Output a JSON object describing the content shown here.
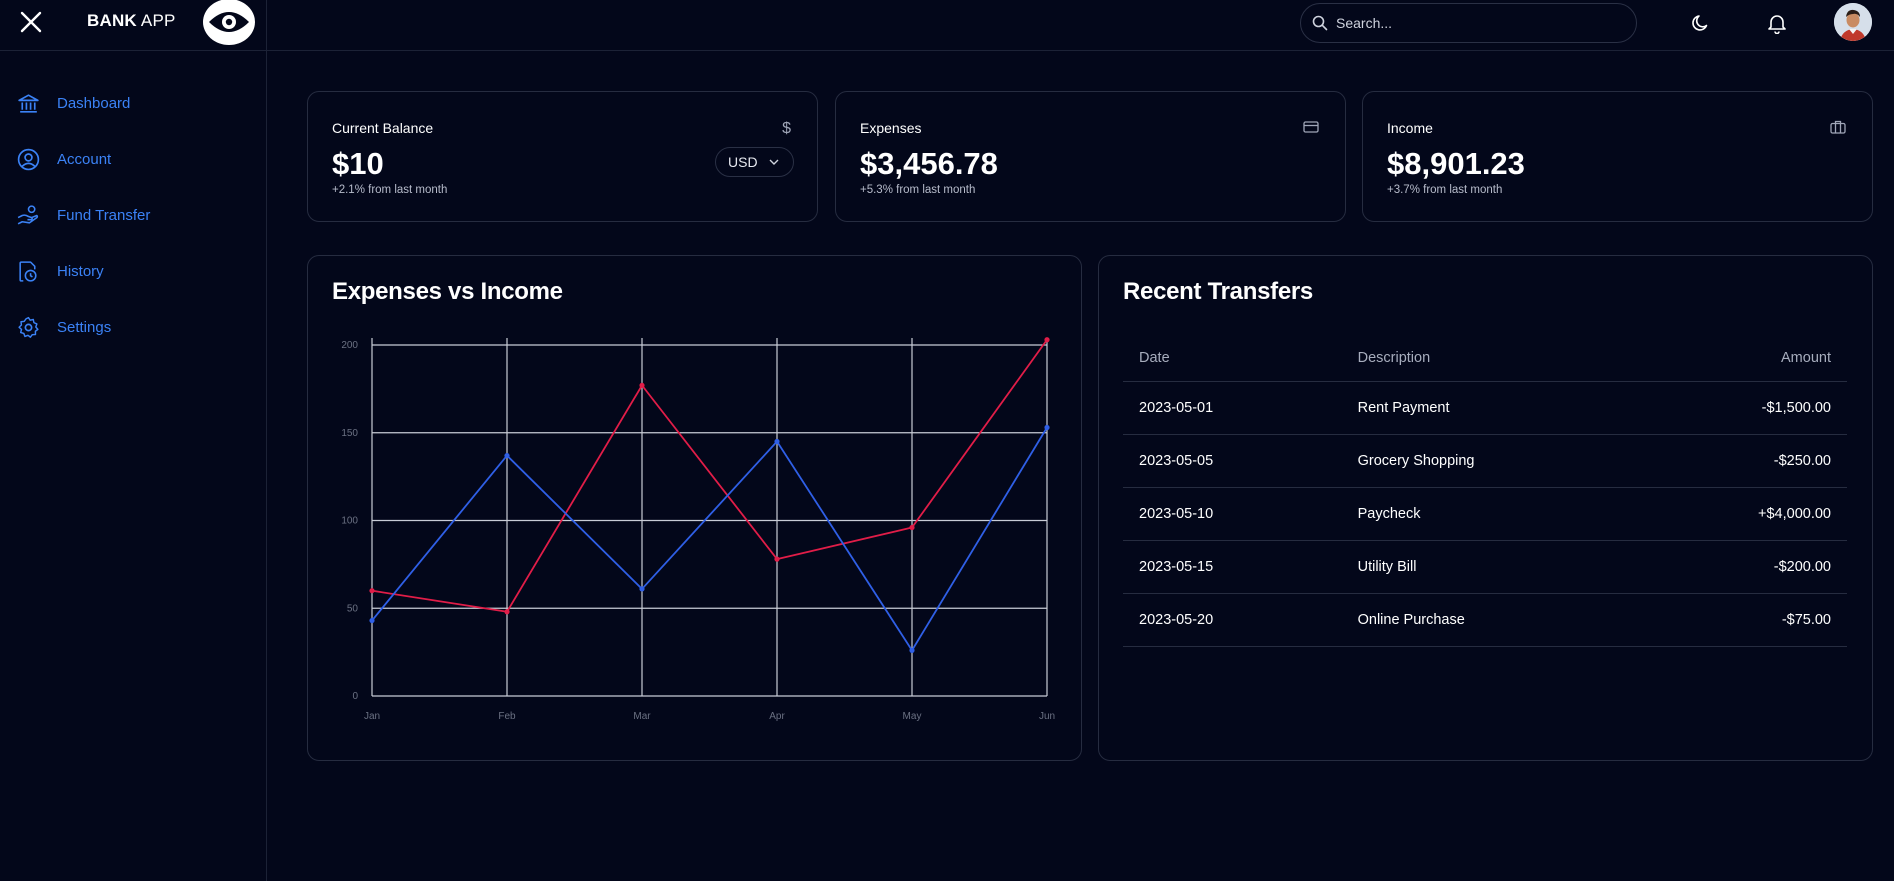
{
  "app": {
    "brand_bold": "BANK",
    "brand_light": " APP"
  },
  "header": {
    "search_placeholder": "Search..."
  },
  "sidebar": {
    "items": [
      {
        "label": "Dashboard",
        "icon": "bank-icon"
      },
      {
        "label": "Account",
        "icon": "user-circle-icon"
      },
      {
        "label": "Fund Transfer",
        "icon": "hand-coins-icon"
      },
      {
        "label": "History",
        "icon": "clock-file-icon"
      },
      {
        "label": "Settings",
        "icon": "gear-icon"
      }
    ]
  },
  "stats": {
    "balance": {
      "label": "Current Balance",
      "value": "$10",
      "sub": "+2.1% from last month",
      "icon": "dollar-icon",
      "currency": "USD"
    },
    "expenses": {
      "label": "Expenses",
      "value": "$3,456.78",
      "sub": "+5.3% from last month",
      "icon": "credit-card-icon"
    },
    "income": {
      "label": "Income",
      "value": "$8,901.23",
      "sub": "+3.7% from last month",
      "icon": "briefcase-icon"
    }
  },
  "chart_panel": {
    "title": "Expenses vs Income"
  },
  "chart_data": {
    "type": "line",
    "categories": [
      "Jan",
      "Feb",
      "Mar",
      "Apr",
      "May",
      "Jun"
    ],
    "ylim": [
      0,
      200
    ],
    "yticks": [
      0,
      50,
      100,
      150,
      200
    ],
    "grid": true,
    "series": [
      {
        "values": [
          60,
          48,
          177,
          78,
          96,
          203
        ],
        "color": "#e11d48"
      },
      {
        "values": [
          43,
          137,
          61,
          145,
          26,
          153
        ],
        "color": "#2f5fe6"
      }
    ]
  },
  "transfers": {
    "title": "Recent Transfers",
    "columns": {
      "date": "Date",
      "description": "Description",
      "amount": "Amount"
    },
    "rows": [
      {
        "date": "2023-05-01",
        "description": "Rent Payment",
        "amount": "-$1,500.00"
      },
      {
        "date": "2023-05-05",
        "description": "Grocery Shopping",
        "amount": "-$250.00"
      },
      {
        "date": "2023-05-10",
        "description": "Paycheck",
        "amount": "+$4,000.00"
      },
      {
        "date": "2023-05-15",
        "description": "Utility Bill",
        "amount": "-$200.00"
      },
      {
        "date": "2023-05-20",
        "description": "Online Purchase",
        "amount": "-$75.00"
      }
    ]
  },
  "colors": {
    "background": "#03071a",
    "accent": "#3b82f6",
    "expense_line": "#e11d48",
    "income_line": "#2f5fe6"
  }
}
